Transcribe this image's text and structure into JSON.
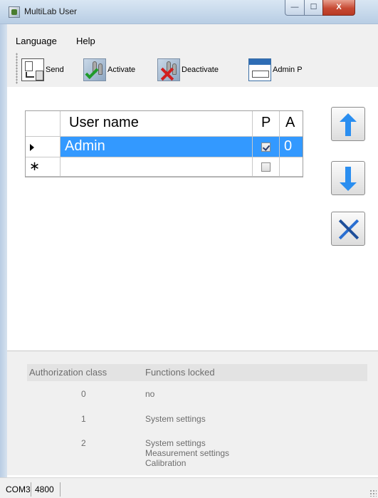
{
  "window": {
    "title": "MultiLab User",
    "min_label": "—",
    "max_label": "☐",
    "close_label": "X"
  },
  "menu": {
    "items": [
      {
        "label": "Language"
      },
      {
        "label": "Help"
      }
    ]
  },
  "toolbar": {
    "send_label": "Send",
    "activate_label": "Activate",
    "deactivate_label": "Deactivate",
    "admin_label": "Admin P"
  },
  "users_grid": {
    "columns": [
      "User name",
      "P",
      "A"
    ],
    "rows": [
      {
        "name": "Admin",
        "p_checked": true,
        "a": "0",
        "selected": true
      },
      {
        "name": "",
        "p_checked": false,
        "a": "",
        "new_row_marker": "∗"
      }
    ]
  },
  "side_buttons": {
    "up_icon": "arrow-up-icon",
    "down_icon": "arrow-down-icon",
    "delete_icon": "delete-x-icon"
  },
  "authorization_table": {
    "headers": [
      "Authorization class",
      "Functions locked"
    ],
    "rows": [
      {
        "class": "0",
        "functions": [
          "no"
        ]
      },
      {
        "class": "1",
        "functions": [
          "System settings"
        ]
      },
      {
        "class": "2",
        "functions": [
          "System settings",
          "Measurement settings",
          "Calibration"
        ]
      }
    ]
  },
  "statusbar": {
    "port": "COM3",
    "baud": "4800"
  }
}
